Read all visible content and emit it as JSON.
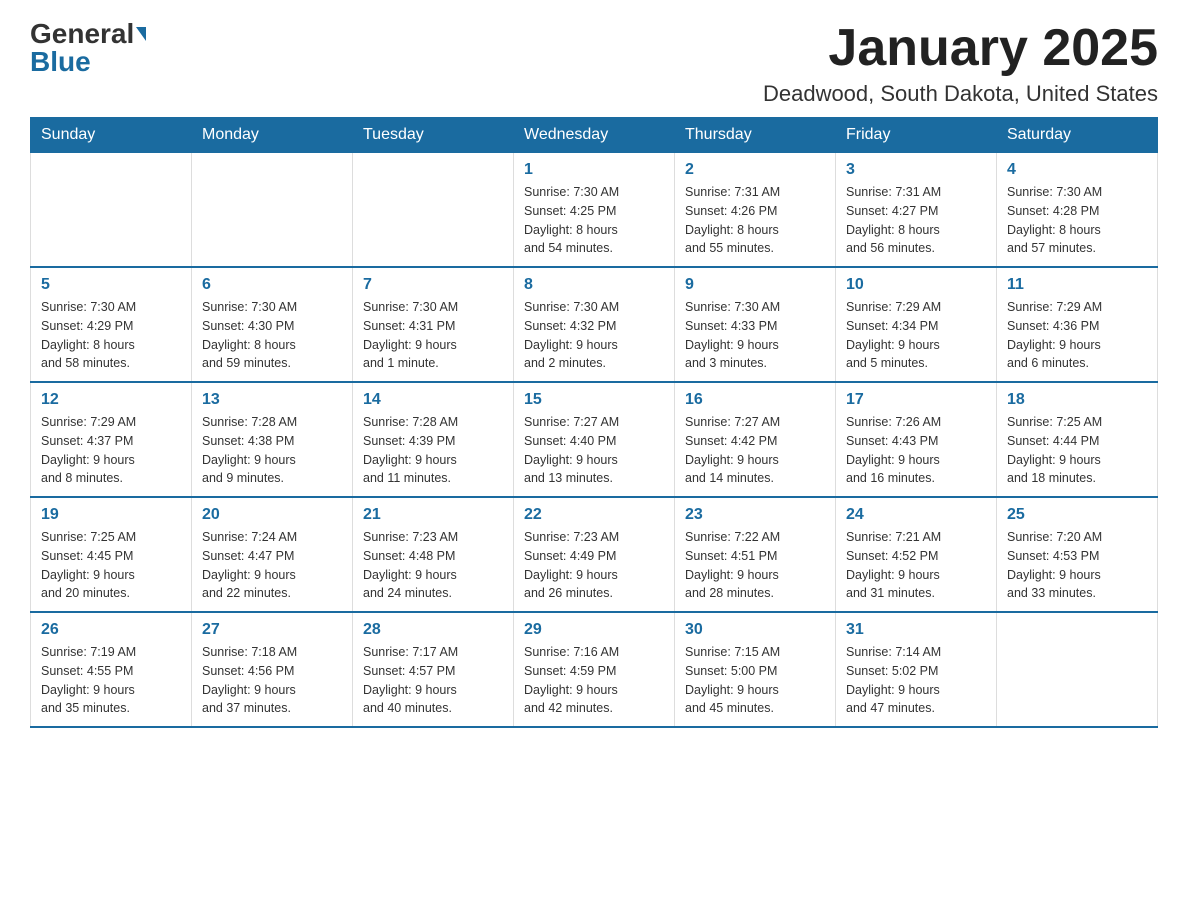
{
  "header": {
    "logo_general": "General",
    "logo_blue": "Blue",
    "title": "January 2025",
    "subtitle": "Deadwood, South Dakota, United States"
  },
  "days_of_week": [
    "Sunday",
    "Monday",
    "Tuesday",
    "Wednesday",
    "Thursday",
    "Friday",
    "Saturday"
  ],
  "weeks": [
    [
      {
        "day": "",
        "info": ""
      },
      {
        "day": "",
        "info": ""
      },
      {
        "day": "",
        "info": ""
      },
      {
        "day": "1",
        "info": "Sunrise: 7:30 AM\nSunset: 4:25 PM\nDaylight: 8 hours\nand 54 minutes."
      },
      {
        "day": "2",
        "info": "Sunrise: 7:31 AM\nSunset: 4:26 PM\nDaylight: 8 hours\nand 55 minutes."
      },
      {
        "day": "3",
        "info": "Sunrise: 7:31 AM\nSunset: 4:27 PM\nDaylight: 8 hours\nand 56 minutes."
      },
      {
        "day": "4",
        "info": "Sunrise: 7:30 AM\nSunset: 4:28 PM\nDaylight: 8 hours\nand 57 minutes."
      }
    ],
    [
      {
        "day": "5",
        "info": "Sunrise: 7:30 AM\nSunset: 4:29 PM\nDaylight: 8 hours\nand 58 minutes."
      },
      {
        "day": "6",
        "info": "Sunrise: 7:30 AM\nSunset: 4:30 PM\nDaylight: 8 hours\nand 59 minutes."
      },
      {
        "day": "7",
        "info": "Sunrise: 7:30 AM\nSunset: 4:31 PM\nDaylight: 9 hours\nand 1 minute."
      },
      {
        "day": "8",
        "info": "Sunrise: 7:30 AM\nSunset: 4:32 PM\nDaylight: 9 hours\nand 2 minutes."
      },
      {
        "day": "9",
        "info": "Sunrise: 7:30 AM\nSunset: 4:33 PM\nDaylight: 9 hours\nand 3 minutes."
      },
      {
        "day": "10",
        "info": "Sunrise: 7:29 AM\nSunset: 4:34 PM\nDaylight: 9 hours\nand 5 minutes."
      },
      {
        "day": "11",
        "info": "Sunrise: 7:29 AM\nSunset: 4:36 PM\nDaylight: 9 hours\nand 6 minutes."
      }
    ],
    [
      {
        "day": "12",
        "info": "Sunrise: 7:29 AM\nSunset: 4:37 PM\nDaylight: 9 hours\nand 8 minutes."
      },
      {
        "day": "13",
        "info": "Sunrise: 7:28 AM\nSunset: 4:38 PM\nDaylight: 9 hours\nand 9 minutes."
      },
      {
        "day": "14",
        "info": "Sunrise: 7:28 AM\nSunset: 4:39 PM\nDaylight: 9 hours\nand 11 minutes."
      },
      {
        "day": "15",
        "info": "Sunrise: 7:27 AM\nSunset: 4:40 PM\nDaylight: 9 hours\nand 13 minutes."
      },
      {
        "day": "16",
        "info": "Sunrise: 7:27 AM\nSunset: 4:42 PM\nDaylight: 9 hours\nand 14 minutes."
      },
      {
        "day": "17",
        "info": "Sunrise: 7:26 AM\nSunset: 4:43 PM\nDaylight: 9 hours\nand 16 minutes."
      },
      {
        "day": "18",
        "info": "Sunrise: 7:25 AM\nSunset: 4:44 PM\nDaylight: 9 hours\nand 18 minutes."
      }
    ],
    [
      {
        "day": "19",
        "info": "Sunrise: 7:25 AM\nSunset: 4:45 PM\nDaylight: 9 hours\nand 20 minutes."
      },
      {
        "day": "20",
        "info": "Sunrise: 7:24 AM\nSunset: 4:47 PM\nDaylight: 9 hours\nand 22 minutes."
      },
      {
        "day": "21",
        "info": "Sunrise: 7:23 AM\nSunset: 4:48 PM\nDaylight: 9 hours\nand 24 minutes."
      },
      {
        "day": "22",
        "info": "Sunrise: 7:23 AM\nSunset: 4:49 PM\nDaylight: 9 hours\nand 26 minutes."
      },
      {
        "day": "23",
        "info": "Sunrise: 7:22 AM\nSunset: 4:51 PM\nDaylight: 9 hours\nand 28 minutes."
      },
      {
        "day": "24",
        "info": "Sunrise: 7:21 AM\nSunset: 4:52 PM\nDaylight: 9 hours\nand 31 minutes."
      },
      {
        "day": "25",
        "info": "Sunrise: 7:20 AM\nSunset: 4:53 PM\nDaylight: 9 hours\nand 33 minutes."
      }
    ],
    [
      {
        "day": "26",
        "info": "Sunrise: 7:19 AM\nSunset: 4:55 PM\nDaylight: 9 hours\nand 35 minutes."
      },
      {
        "day": "27",
        "info": "Sunrise: 7:18 AM\nSunset: 4:56 PM\nDaylight: 9 hours\nand 37 minutes."
      },
      {
        "day": "28",
        "info": "Sunrise: 7:17 AM\nSunset: 4:57 PM\nDaylight: 9 hours\nand 40 minutes."
      },
      {
        "day": "29",
        "info": "Sunrise: 7:16 AM\nSunset: 4:59 PM\nDaylight: 9 hours\nand 42 minutes."
      },
      {
        "day": "30",
        "info": "Sunrise: 7:15 AM\nSunset: 5:00 PM\nDaylight: 9 hours\nand 45 minutes."
      },
      {
        "day": "31",
        "info": "Sunrise: 7:14 AM\nSunset: 5:02 PM\nDaylight: 9 hours\nand 47 minutes."
      },
      {
        "day": "",
        "info": ""
      }
    ]
  ]
}
